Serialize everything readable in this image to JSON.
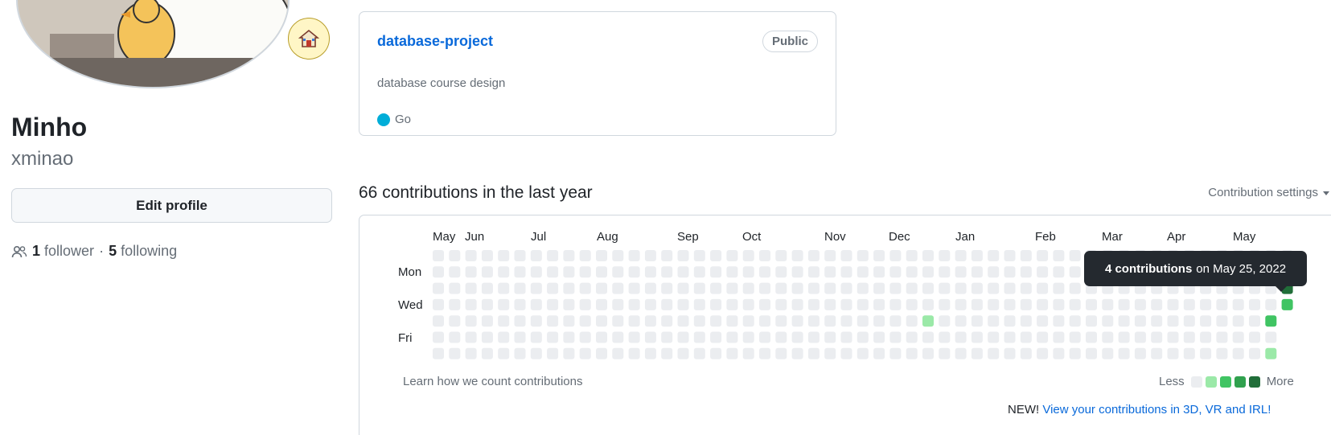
{
  "profile": {
    "name": "Minho",
    "login": "xminao",
    "edit_label": "Edit profile",
    "followers_count": "1",
    "followers_label": "follower",
    "separator": "·",
    "following_count": "5",
    "following_label": "following",
    "status_icon": "house-emoji-icon"
  },
  "repo": {
    "name": "database-project",
    "visibility": "Public",
    "description": "database course design",
    "language": "Go",
    "language_color": "#00ADD8"
  },
  "contributions": {
    "title": "66 contributions in the last year",
    "settings_label": "Contribution settings",
    "months": [
      "May",
      "Jun",
      "Jul",
      "Aug",
      "Sep",
      "Oct",
      "Nov",
      "Dec",
      "Jan",
      "Feb",
      "Mar",
      "Apr",
      "May"
    ],
    "day_labels": [
      "Mon",
      "Wed",
      "Fri"
    ],
    "weeks": 53,
    "level_colors": [
      "#ebedf0",
      "#9be9a8",
      "#40c463",
      "#30a14e",
      "#216e39"
    ],
    "active_cells": [
      {
        "week": 30,
        "day": 4,
        "level": 1
      },
      {
        "week": 51,
        "day": 4,
        "level": 2
      },
      {
        "week": 51,
        "day": 6,
        "level": 1
      },
      {
        "week": 52,
        "day": 2,
        "level": 4
      },
      {
        "week": 52,
        "day": 3,
        "level": 2
      }
    ],
    "learn_label": "Learn how we count contributions",
    "legend_less": "Less",
    "legend_more": "More",
    "new_prefix": "NEW!",
    "new_link": "View your contributions in 3D, VR and IRL!",
    "tooltip_count": "4 contributions",
    "tooltip_date": "on May 25, 2022"
  }
}
